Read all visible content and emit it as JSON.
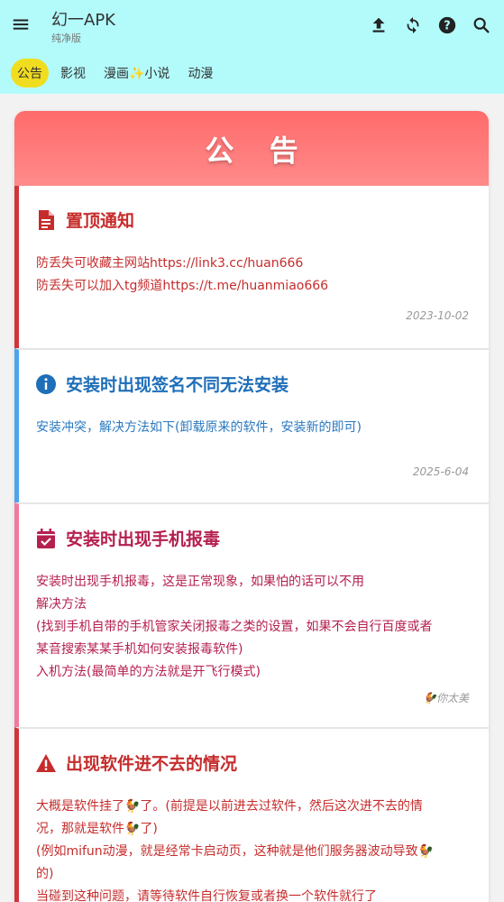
{
  "appbar": {
    "title": "幻一APK",
    "subtitle": "纯净版",
    "icons": [
      "menu-icon",
      "upload-icon",
      "refresh-icon",
      "help-icon",
      "search-icon"
    ]
  },
  "tabs": [
    {
      "label": "公告",
      "active": true
    },
    {
      "label": "影视",
      "active": false
    },
    {
      "label": "漫画✨小说",
      "active": false
    },
    {
      "label": "动漫",
      "active": false
    }
  ],
  "board": {
    "header": "公 告",
    "notices": [
      {
        "icon": "document-icon",
        "title": "置顶通知",
        "lines": [
          "防丢失可收藏主网站https://link3.cc/huan666",
          "防丢失可以加入tg频道https://t.me/huanmiao666"
        ],
        "date": "2023-10-02"
      },
      {
        "icon": "info-icon",
        "title": "安装时出现签名不同无法安装",
        "lines": [
          "安装冲突，解决方法如下(卸载原来的软件，安装新的即可)"
        ],
        "date": "2025-6-04"
      },
      {
        "icon": "calendar-check-icon",
        "title": "安装时出现手机报毒",
        "lines": [
          "安装时出现手机报毒，这是正常现象，如果怕的话可以不用",
          "解决方法",
          "(找到手机自带的手机管家关闭报毒之类的设置，如果不会自行百度或者",
          "某音搜索某某手机如何安装报毒软件)",
          "入机方法(最简单的方法就是开飞行模式)"
        ],
        "date": "🐓你太美"
      },
      {
        "icon": "warning-icon",
        "title": "出现软件进不去的情况",
        "lines": [
          "大概是软件挂了🐓了。(前提是以前进去过软件，然后这次进不去的情",
          "况，那就是软件🐓了)",
          "(例如mifun动漫，就是经常卡启动页，这种就是他们服务器波动导致🐓",
          "的)",
          "当碰到这种问题，请等待软件自行恢复或者换一个软件就行了"
        ],
        "date": ""
      }
    ]
  },
  "colors": {
    "appbar_bg": "#b3fbfb",
    "tab_active": "#f1dd1f",
    "header_gradient_start": "#ff6b6b",
    "danger": "#d0343a",
    "info": "#4ea4ea",
    "pink": "#f07a9e"
  }
}
